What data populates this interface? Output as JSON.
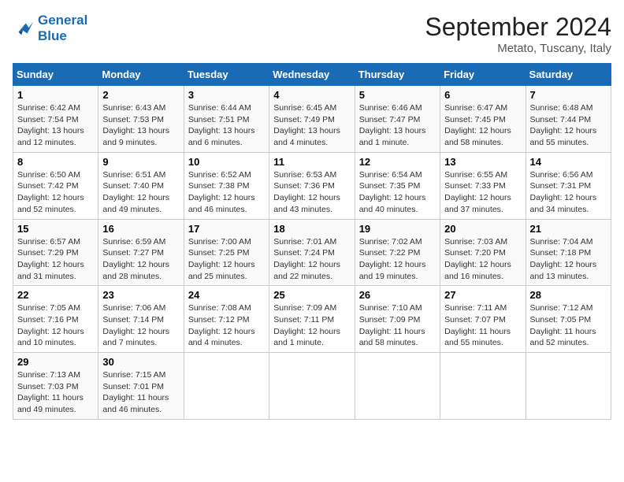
{
  "header": {
    "logo_line1": "General",
    "logo_line2": "Blue",
    "month": "September 2024",
    "location": "Metato, Tuscany, Italy"
  },
  "days_of_week": [
    "Sunday",
    "Monday",
    "Tuesday",
    "Wednesday",
    "Thursday",
    "Friday",
    "Saturday"
  ],
  "weeks": [
    [
      {
        "day": 1,
        "sunrise": "6:42 AM",
        "sunset": "7:54 PM",
        "daylight": "13 hours and 12 minutes."
      },
      {
        "day": 2,
        "sunrise": "6:43 AM",
        "sunset": "7:53 PM",
        "daylight": "13 hours and 9 minutes."
      },
      {
        "day": 3,
        "sunrise": "6:44 AM",
        "sunset": "7:51 PM",
        "daylight": "13 hours and 6 minutes."
      },
      {
        "day": 4,
        "sunrise": "6:45 AM",
        "sunset": "7:49 PM",
        "daylight": "13 hours and 4 minutes."
      },
      {
        "day": 5,
        "sunrise": "6:46 AM",
        "sunset": "7:47 PM",
        "daylight": "13 hours and 1 minute."
      },
      {
        "day": 6,
        "sunrise": "6:47 AM",
        "sunset": "7:45 PM",
        "daylight": "12 hours and 58 minutes."
      },
      {
        "day": 7,
        "sunrise": "6:48 AM",
        "sunset": "7:44 PM",
        "daylight": "12 hours and 55 minutes."
      }
    ],
    [
      {
        "day": 8,
        "sunrise": "6:50 AM",
        "sunset": "7:42 PM",
        "daylight": "12 hours and 52 minutes."
      },
      {
        "day": 9,
        "sunrise": "6:51 AM",
        "sunset": "7:40 PM",
        "daylight": "12 hours and 49 minutes."
      },
      {
        "day": 10,
        "sunrise": "6:52 AM",
        "sunset": "7:38 PM",
        "daylight": "12 hours and 46 minutes."
      },
      {
        "day": 11,
        "sunrise": "6:53 AM",
        "sunset": "7:36 PM",
        "daylight": "12 hours and 43 minutes."
      },
      {
        "day": 12,
        "sunrise": "6:54 AM",
        "sunset": "7:35 PM",
        "daylight": "12 hours and 40 minutes."
      },
      {
        "day": 13,
        "sunrise": "6:55 AM",
        "sunset": "7:33 PM",
        "daylight": "12 hours and 37 minutes."
      },
      {
        "day": 14,
        "sunrise": "6:56 AM",
        "sunset": "7:31 PM",
        "daylight": "12 hours and 34 minutes."
      }
    ],
    [
      {
        "day": 15,
        "sunrise": "6:57 AM",
        "sunset": "7:29 PM",
        "daylight": "12 hours and 31 minutes."
      },
      {
        "day": 16,
        "sunrise": "6:59 AM",
        "sunset": "7:27 PM",
        "daylight": "12 hours and 28 minutes."
      },
      {
        "day": 17,
        "sunrise": "7:00 AM",
        "sunset": "7:25 PM",
        "daylight": "12 hours and 25 minutes."
      },
      {
        "day": 18,
        "sunrise": "7:01 AM",
        "sunset": "7:24 PM",
        "daylight": "12 hours and 22 minutes."
      },
      {
        "day": 19,
        "sunrise": "7:02 AM",
        "sunset": "7:22 PM",
        "daylight": "12 hours and 19 minutes."
      },
      {
        "day": 20,
        "sunrise": "7:03 AM",
        "sunset": "7:20 PM",
        "daylight": "12 hours and 16 minutes."
      },
      {
        "day": 21,
        "sunrise": "7:04 AM",
        "sunset": "7:18 PM",
        "daylight": "12 hours and 13 minutes."
      }
    ],
    [
      {
        "day": 22,
        "sunrise": "7:05 AM",
        "sunset": "7:16 PM",
        "daylight": "12 hours and 10 minutes."
      },
      {
        "day": 23,
        "sunrise": "7:06 AM",
        "sunset": "7:14 PM",
        "daylight": "12 hours and 7 minutes."
      },
      {
        "day": 24,
        "sunrise": "7:08 AM",
        "sunset": "7:12 PM",
        "daylight": "12 hours and 4 minutes."
      },
      {
        "day": 25,
        "sunrise": "7:09 AM",
        "sunset": "7:11 PM",
        "daylight": "12 hours and 1 minute."
      },
      {
        "day": 26,
        "sunrise": "7:10 AM",
        "sunset": "7:09 PM",
        "daylight": "11 hours and 58 minutes."
      },
      {
        "day": 27,
        "sunrise": "7:11 AM",
        "sunset": "7:07 PM",
        "daylight": "11 hours and 55 minutes."
      },
      {
        "day": 28,
        "sunrise": "7:12 AM",
        "sunset": "7:05 PM",
        "daylight": "11 hours and 52 minutes."
      }
    ],
    [
      {
        "day": 29,
        "sunrise": "7:13 AM",
        "sunset": "7:03 PM",
        "daylight": "11 hours and 49 minutes."
      },
      {
        "day": 30,
        "sunrise": "7:15 AM",
        "sunset": "7:01 PM",
        "daylight": "11 hours and 46 minutes."
      },
      null,
      null,
      null,
      null,
      null
    ]
  ]
}
